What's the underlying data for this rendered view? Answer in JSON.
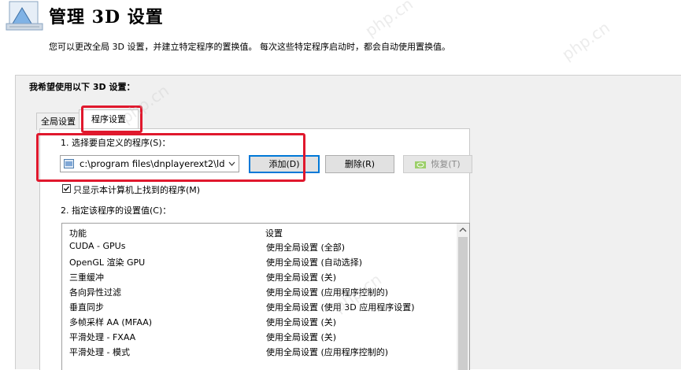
{
  "header": {
    "title": "管理 3D 设置",
    "icon": "nvidia-3d-settings-icon"
  },
  "description": "您可以更改全局 3D 设置，并建立特定程序的置换值。 每次这些特定程序启动时，都会自动使用置换值。",
  "group": {
    "title": "我希望使用以下 3D 设置：",
    "tabs": [
      {
        "label": "全局设置",
        "active": false
      },
      {
        "label": "程序设置",
        "active": true
      }
    ]
  },
  "program_tab": {
    "select_label": "1. 选择要自定义的程序(S)：",
    "program_value": "c:\\program files\\dnplayerext2\\ld...",
    "buttons": {
      "add": "添加(D)",
      "delete": "删除(R)",
      "restore": "恢复(T)"
    },
    "checkbox": {
      "label": "只显示本计算机上找到的程序(M)",
      "checked": true
    },
    "specify_label": "2. 指定该程序的设置值(C)："
  },
  "settings_table": {
    "headers": {
      "feature": "功能",
      "setting": "设置"
    },
    "rows": [
      {
        "feature": "CUDA - GPUs",
        "setting": "使用全局设置 (全部)"
      },
      {
        "feature": "OpenGL 渲染 GPU",
        "setting": "使用全局设置 (自动选择)"
      },
      {
        "feature": "三重缓冲",
        "setting": "使用全局设置 (关)"
      },
      {
        "feature": "各向异性过滤",
        "setting": "使用全局设置 (应用程序控制的)"
      },
      {
        "feature": "垂直同步",
        "setting": "使用全局设置 (使用 3D 应用程序设置)"
      },
      {
        "feature": "多帧采样 AA (MFAA)",
        "setting": "使用全局设置 (关)"
      },
      {
        "feature": "平滑处理 - FXAA",
        "setting": "使用全局设置 (关)"
      },
      {
        "feature": "平滑处理 - 模式",
        "setting": "使用全局设置 (应用程序控制的)"
      }
    ]
  },
  "watermark": "php.cn",
  "colors": {
    "highlight_box": "#e0182d",
    "nvidia_green": "#76b900",
    "button_focus": "#0078d7"
  }
}
